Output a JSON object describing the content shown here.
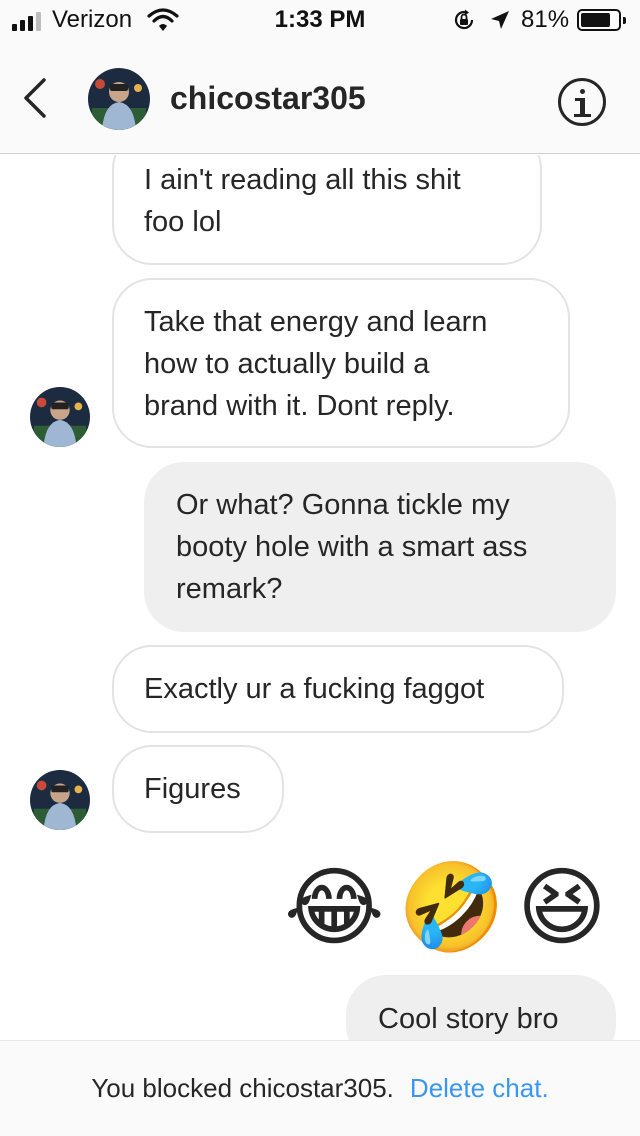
{
  "status_bar": {
    "carrier": "Verizon",
    "time": "1:33 PM",
    "battery_percent": "81%",
    "battery_level": 0.81,
    "signal_bars": 3
  },
  "header": {
    "username": "chicostar305",
    "back_icon": "chevron-left-icon",
    "info_icon": "info-icon"
  },
  "messages": [
    {
      "direction": "incoming",
      "text_lines": [
        "I ain't reading all this shit",
        "foo lol"
      ]
    },
    {
      "direction": "incoming",
      "text_lines": [
        "Take that energy and learn",
        "how to actually build a",
        "brand with it. Dont reply."
      ]
    },
    {
      "direction": "outgoing",
      "text_lines": [
        "Or what? Gonna tickle my",
        "booty hole with a smart ass",
        "remark?"
      ]
    },
    {
      "direction": "incoming",
      "text_lines": [
        "Exactly ur a fucking faggot"
      ]
    },
    {
      "direction": "incoming",
      "text_lines": [
        "Figures"
      ]
    },
    {
      "direction": "outgoing",
      "emojis": [
        "😂",
        "🤣",
        "😆"
      ]
    },
    {
      "direction": "outgoing",
      "text_lines": [
        "Cool story bro"
      ]
    }
  ],
  "footer": {
    "notice": "You blocked chicostar305.",
    "action": "Delete chat."
  },
  "colors": {
    "link": "#3897f0",
    "outgoing_bubble": "#efefef",
    "incoming_border": "#e3e3e3",
    "text": "#262626"
  }
}
